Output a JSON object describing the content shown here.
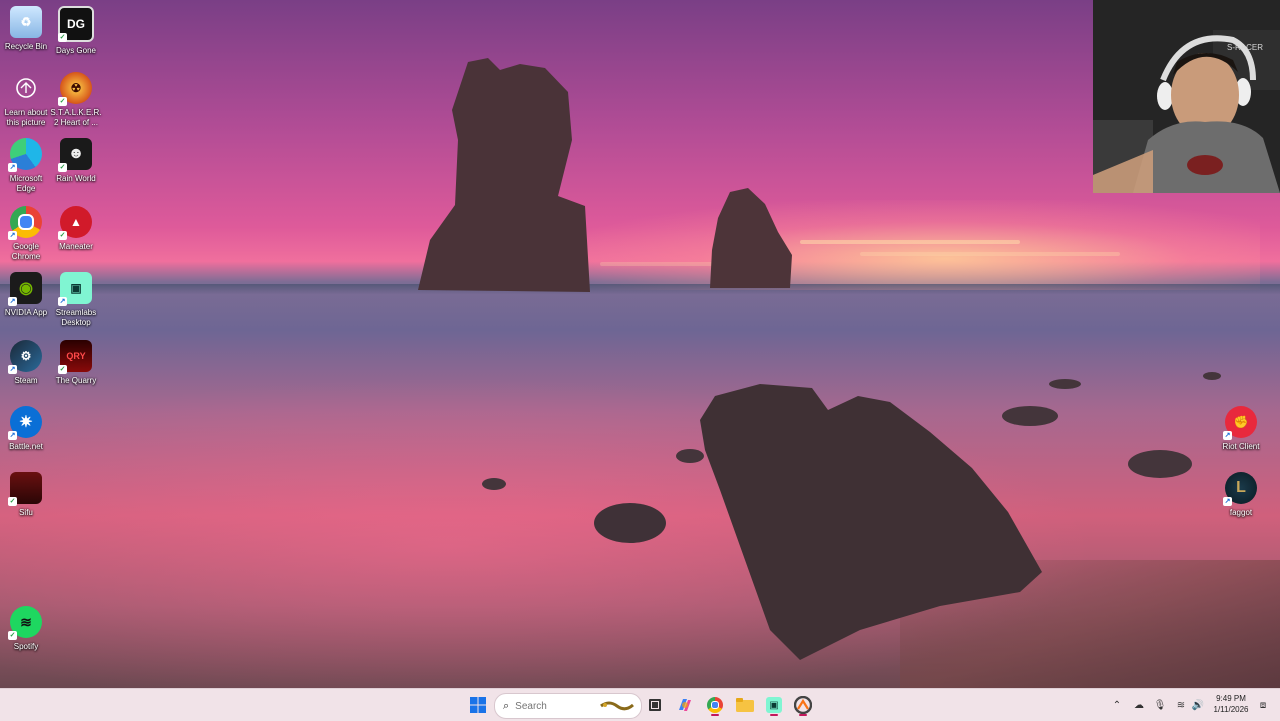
{
  "desktop": {
    "icons_left_col1": [
      {
        "label": "Recycle Bin",
        "icon": "recycle-bin-icon"
      },
      {
        "label": "Learn about this picture",
        "icon": "camera-icon"
      },
      {
        "label": "Microsoft Edge",
        "icon": "edge-icon"
      },
      {
        "label": "Google Chrome",
        "icon": "chrome-icon"
      },
      {
        "label": "NVIDIA App",
        "icon": "nvidia-icon"
      },
      {
        "label": "Steam",
        "icon": "steam-icon"
      },
      {
        "label": "Battle.net",
        "icon": "battlenet-icon"
      },
      {
        "label": "Sifu",
        "icon": "sifu-icon"
      },
      {
        "label": "Spotify",
        "icon": "spotify-icon"
      }
    ],
    "icons_left_col2": [
      {
        "label": "Days Gone",
        "icon": "days-gone-icon",
        "badge": "DG"
      },
      {
        "label": "S.T.A.L.K.E.R. 2 Heart of ...",
        "icon": "stalker-icon"
      },
      {
        "label": "Rain World",
        "icon": "rain-world-icon"
      },
      {
        "label": "Maneater",
        "icon": "maneater-icon"
      },
      {
        "label": "Streamlabs Desktop",
        "icon": "streamlabs-icon"
      },
      {
        "label": "The Quarry",
        "icon": "the-quarry-icon"
      }
    ],
    "icons_right": [
      {
        "label": "Riot Client",
        "icon": "riot-client-icon"
      },
      {
        "label": "faggot",
        "icon": "league-icon"
      }
    ]
  },
  "taskbar": {
    "search_placeholder": "Search",
    "pinned": [
      "start-icon",
      "task-view-icon",
      "copilot-icon",
      "chrome-icon",
      "file-explorer-icon",
      "streamlabs-icon",
      "overwatch-icon"
    ],
    "clock_time": "9:49 PM",
    "clock_date": "1/11/2026",
    "colors": {
      "accent": "#c2185b",
      "taskbar_bg": "#f1e3e8"
    }
  },
  "webcam": {
    "visible_text": "S-RACER"
  }
}
